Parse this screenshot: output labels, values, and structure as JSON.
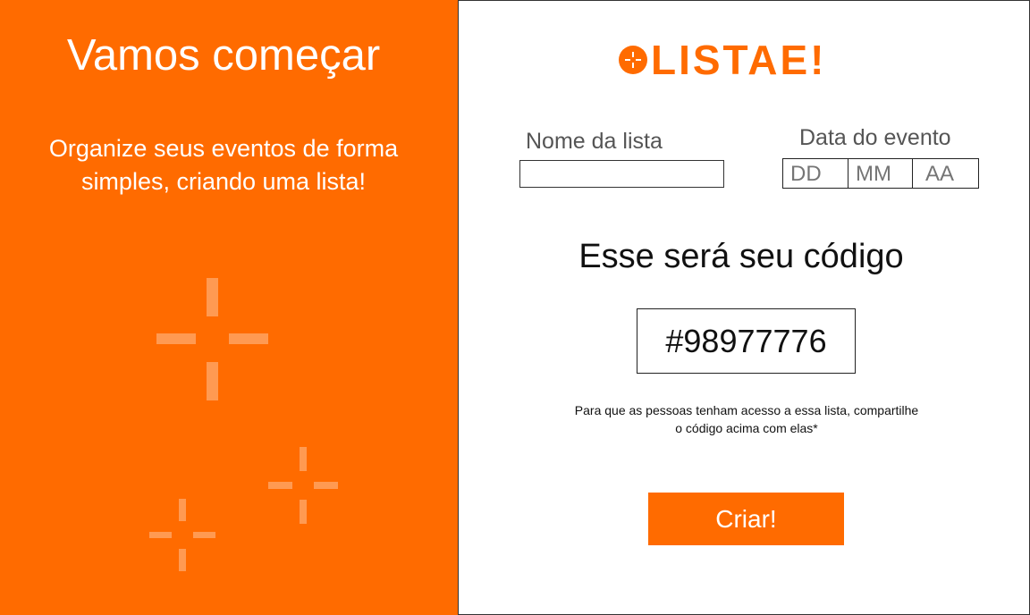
{
  "intro": {
    "title": "Vamos começar",
    "subtitle_line1": "Organize seus eventos de forma",
    "subtitle_line2": "simples, criando uma lista!"
  },
  "brand": {
    "logo_text": "LISTAE!",
    "color": "#ff6b00"
  },
  "form": {
    "list_name_label": "Nome da lista",
    "list_name_value": "",
    "event_date_label": "Data do evento",
    "day_placeholder": "DD",
    "month_placeholder": "MM",
    "year_placeholder": "AA"
  },
  "code": {
    "heading": "Esse será seu código",
    "value": "#98977776",
    "hint_line1": "Para que as pessoas tenham acesso a essa lista, compartilhe",
    "hint_line2": "o código acima com elas*"
  },
  "actions": {
    "create_label": "Criar!"
  },
  "decorations": {
    "left_panel_icons": [
      "sparkle-icon",
      "sparkle-icon",
      "sparkle-icon"
    ],
    "logo_icon": "plus-circle-icon"
  }
}
